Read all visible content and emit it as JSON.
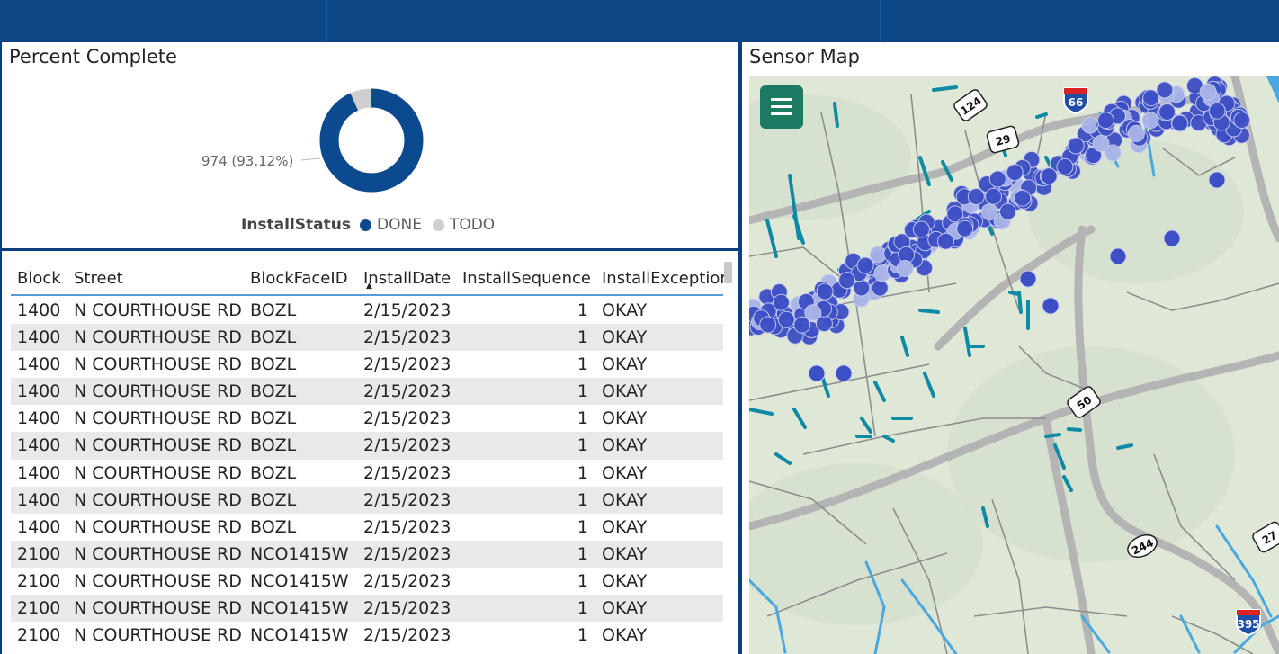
{
  "donut": {
    "title": "Percent Complete",
    "data_label": "974 (93.12%)",
    "legend_title": "InstallStatus",
    "legend": [
      {
        "label": "DONE",
        "color": "#0b4a8e"
      },
      {
        "label": "TODO",
        "color": "#cfcfcf"
      }
    ],
    "done_fraction": 0.9312
  },
  "table": {
    "headers": [
      "Block",
      "Street",
      "BlockFaceID",
      "InstallDate",
      "InstallSequence",
      "InstallExceptior"
    ],
    "rows": [
      [
        "1400",
        "N COURTHOUSE RD",
        "BOZL",
        "2/15/2023",
        "1",
        "OKAY"
      ],
      [
        "1400",
        "N COURTHOUSE RD",
        "BOZL",
        "2/15/2023",
        "1",
        "OKAY"
      ],
      [
        "1400",
        "N COURTHOUSE RD",
        "BOZL",
        "2/15/2023",
        "1",
        "OKAY"
      ],
      [
        "1400",
        "N COURTHOUSE RD",
        "BOZL",
        "2/15/2023",
        "1",
        "OKAY"
      ],
      [
        "1400",
        "N COURTHOUSE RD",
        "BOZL",
        "2/15/2023",
        "1",
        "OKAY"
      ],
      [
        "1400",
        "N COURTHOUSE RD",
        "BOZL",
        "2/15/2023",
        "1",
        "OKAY"
      ],
      [
        "1400",
        "N COURTHOUSE RD",
        "BOZL",
        "2/15/2023",
        "1",
        "OKAY"
      ],
      [
        "1400",
        "N COURTHOUSE RD",
        "BOZL",
        "2/15/2023",
        "1",
        "OKAY"
      ],
      [
        "1400",
        "N COURTHOUSE RD",
        "BOZL",
        "2/15/2023",
        "1",
        "OKAY"
      ],
      [
        "2100",
        "N COURTHOUSE RD",
        "NCO1415W",
        "2/15/2023",
        "1",
        "OKAY"
      ],
      [
        "2100",
        "N COURTHOUSE RD",
        "NCO1415W",
        "2/15/2023",
        "1",
        "OKAY"
      ],
      [
        "2100",
        "N COURTHOUSE RD",
        "NCO1415W",
        "2/15/2023",
        "1",
        "OKAY"
      ],
      [
        "2100",
        "N COURTHOUSE RD",
        "NCO1415W",
        "2/15/2023",
        "1",
        "OKAY"
      ]
    ]
  },
  "map": {
    "title": "Sensor Map",
    "menu_icon": "hamburger-menu-icon",
    "route_labels": [
      "124",
      "29",
      "66",
      "50",
      "244",
      "27",
      "395"
    ],
    "colors": {
      "sensor": "#3d4fc4",
      "segment": "#0e8aa5",
      "road": "#9a9a9a",
      "water": "#4aa8e0",
      "land": "#dfe8d6"
    }
  }
}
